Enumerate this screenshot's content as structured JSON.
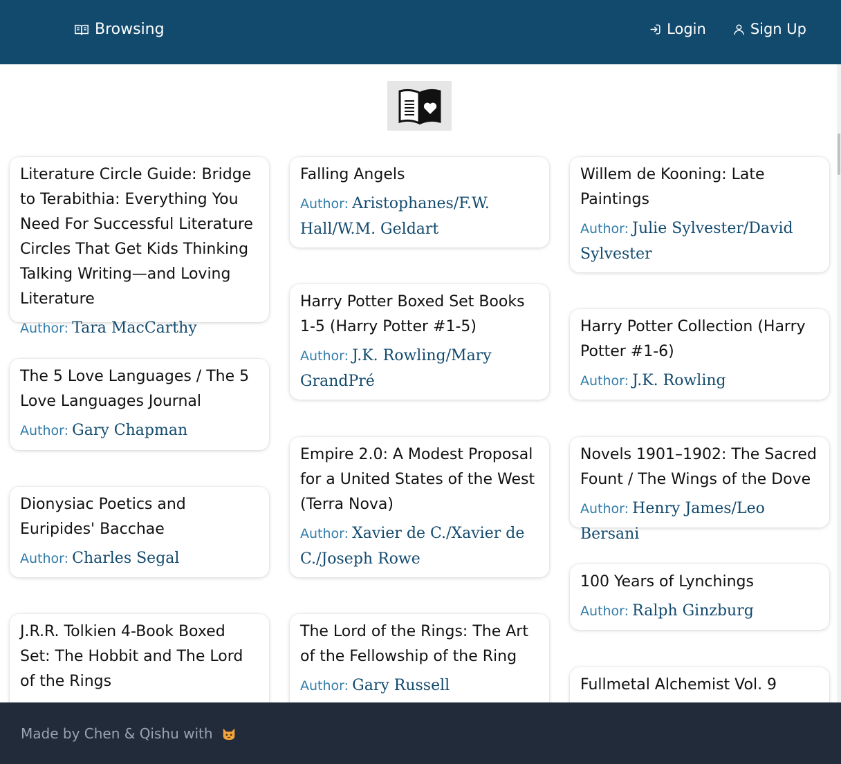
{
  "nav": {
    "brand_label": "Browsing",
    "brand_icon": "open-book-icon",
    "login_label": "Login",
    "login_icon": "login-arrow-icon",
    "signup_label": "Sign Up",
    "signup_icon": "user-icon"
  },
  "logo": {
    "icon": "book-heart-logo"
  },
  "author_prefix": "Author:",
  "columns": [
    [
      {
        "title": "Literature Circle Guide: Bridge to Terabithia: Everything You Need For Successful Literature Circles That Get Kids Thinking Talking Writing—and Loving Literature",
        "author": "Tara MacCarthy"
      },
      {
        "title": "The 5 Love Languages / The 5 Love Languages Journal",
        "author": "Gary Chapman"
      },
      {
        "title": "Dionysiac Poetics and Euripides' Bacchae",
        "author": "Charles Segal"
      },
      {
        "title": "J.R.R. Tolkien 4-Book Boxed Set: The Hobbit and The Lord of the Rings",
        "author": ""
      }
    ],
    [
      {
        "title": "Falling Angels",
        "author": "Aristophanes/F.W. Hall/W.M. Geldart"
      },
      {
        "title": "Harry Potter Boxed Set Books 1-5 (Harry Potter #1-5)",
        "author": "J.K. Rowling/Mary GrandPré"
      },
      {
        "title": "Empire 2.0: A Modest Proposal for a United States of the West (Terra Nova)",
        "author": "Xavier de C./Xavier de C./Joseph Rowe"
      },
      {
        "title": "The Lord of the Rings: The Art of the Fellowship of the Ring",
        "author": "Gary Russell"
      }
    ],
    [
      {
        "title": "Willem de Kooning: Late Paintings",
        "author": "Julie Sylvester/David Sylvester"
      },
      {
        "title": "Harry Potter Collection (Harry Potter #1-6)",
        "author": "J.K. Rowling"
      },
      {
        "title": "Novels 1901–1902: The Sacred Fount / The Wings of the Dove",
        "author": "Henry James/Leo Bersani"
      },
      {
        "title": "100 Years of Lynchings",
        "author": "Ralph Ginzburg"
      },
      {
        "title": "Fullmetal Alchemist Vol. 9",
        "author": ""
      }
    ]
  ],
  "footer": {
    "text": "Made by Chen & Qishu with",
    "icon": "cat-face-icon"
  }
}
